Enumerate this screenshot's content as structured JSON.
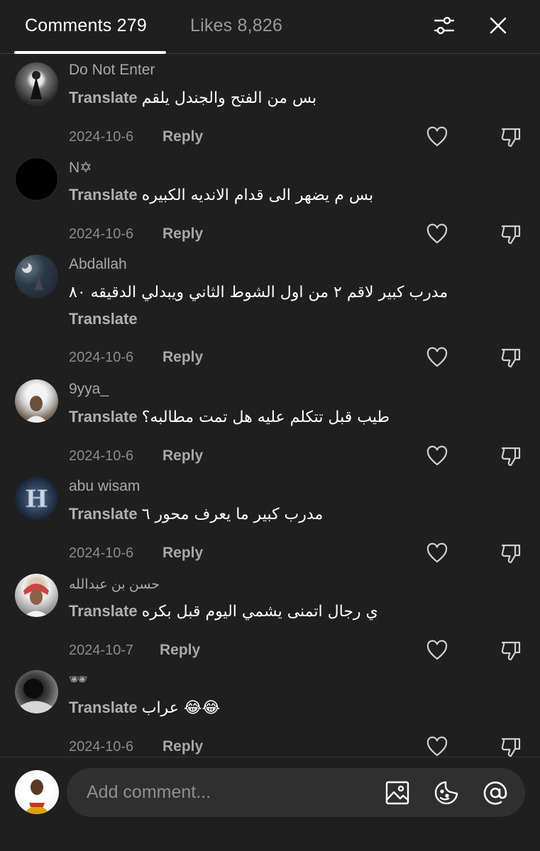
{
  "header": {
    "comments_label": "Comments 279",
    "likes_label": "Likes 8,826",
    "filter_icon": "sliders-icon",
    "close_icon": "close-icon"
  },
  "comments": [
    {
      "username": "Do Not Enter",
      "text": "بس من الفتح والجندل يلقم",
      "translate": "Translate",
      "date": "2024-10-6",
      "reply": "Reply"
    },
    {
      "username": "N✡",
      "text": "بس م يضهر الى قدام الانديه الكبيره",
      "translate": "Translate",
      "date": "2024-10-6",
      "reply": "Reply"
    },
    {
      "username": "Abdallah",
      "text": "مدرب كبير لاقم ٢ من اول الشوط الثاني ويبدلي الدقيقه ٨٠",
      "translate": "Translate",
      "date": "2024-10-6",
      "reply": "Reply"
    },
    {
      "username": "9yya_",
      "text": "طيب قبل تتكلم عليه هل تمت مطالبه؟",
      "translate": "Translate",
      "date": "2024-10-6",
      "reply": "Reply"
    },
    {
      "username": "abu wisam",
      "text": "مدرب كبير ما يعرف محور ٦",
      "translate": "Translate",
      "date": "2024-10-6",
      "reply": "Reply"
    },
    {
      "username": "حسن بن عبدالله",
      "text": "ي رجال اتمنى يشمي اليوم قبل بكره",
      "translate": "Translate",
      "date": "2024-10-7",
      "reply": "Reply"
    },
    {
      "username": "🕶",
      "text": "عراب 😂😂",
      "translate": "Translate",
      "date": "2024-10-6",
      "reply": "Reply"
    }
  ],
  "composer": {
    "placeholder": "Add comment...",
    "icons": [
      "image-icon",
      "emoji-icon",
      "mention-icon"
    ]
  },
  "colors": {
    "background": "#1f1f1f",
    "input_bg": "#2f2f2f",
    "muted_text": "#a8a8a8"
  }
}
